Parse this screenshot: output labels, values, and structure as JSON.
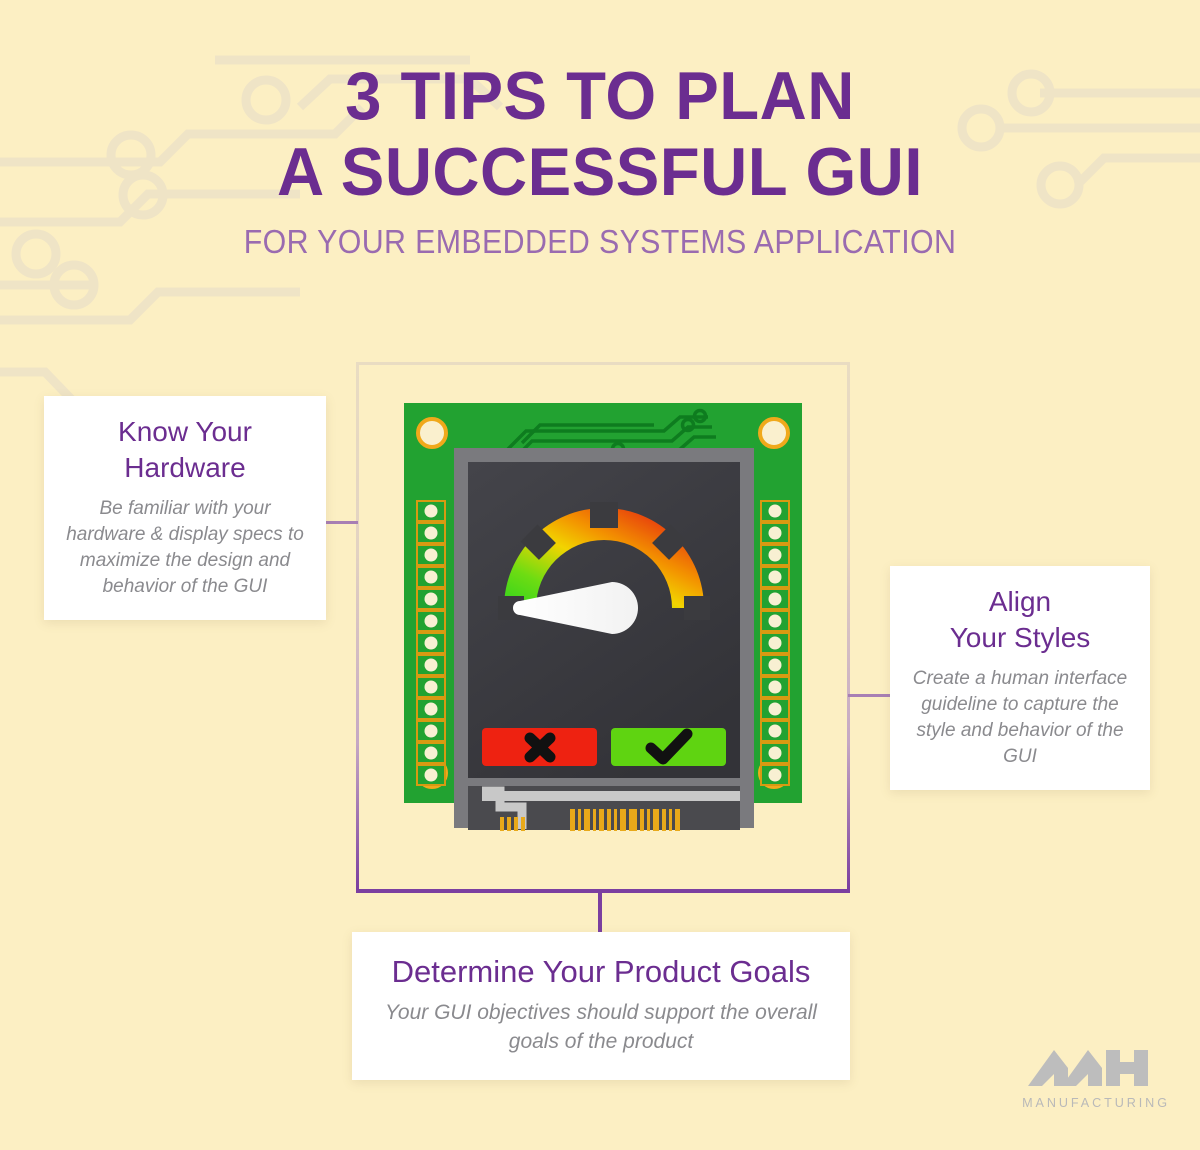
{
  "page": {
    "background_color": "#FCEFC3",
    "accent_purple": "#6B2D90",
    "subtitle_purple": "#9A6BB0",
    "connector_purple": "#A87FB4",
    "body_grey": "#8A8A8E",
    "trace_color": "#EFE4C6"
  },
  "header": {
    "title_line1": "3 TIPS TO PLAN",
    "title_line2": "A SUCCESSFUL GUI",
    "subtitle": "FOR YOUR EMBEDDED SYSTEMS APPLICATION"
  },
  "callouts": [
    {
      "id": "know-your-hardware",
      "title_line1": "Know Your",
      "title_line2": "Hardware",
      "body": "Be familiar with your hardware & display specs to maximize the design and behavior of the GUI"
    },
    {
      "id": "align-your-styles",
      "title_line1": "Align",
      "title_line2": "Your Styles",
      "body": "Create a human interface guideline to capture the style and behavior of the GUI"
    },
    {
      "id": "determine-your-product-goals",
      "title_line1": "Determine Your Product Goals",
      "title_line2": "",
      "body": "Your GUI objectives should support the overall goals of the product"
    }
  ],
  "device": {
    "name": "embedded-display-board",
    "board_color": "#22A231",
    "board_trace_color": "#0F7A20",
    "bezel_color": "#7A7A7E",
    "screen_color": "#3B3B3F",
    "mount_hole_count": 4,
    "pin_pad_count_per_side": 14,
    "pin_pad_color": "#F7EFD0",
    "pin_pad_outline": "#D79A12",
    "gauge": {
      "name": "speedometer-gauge",
      "arc_colors": [
        "#38D430",
        "#8CDC10",
        "#F2D400",
        "#F08A00",
        "#E23A10",
        "#D91A0B"
      ],
      "needle_color": "#FFFFFF",
      "needle_direction": "left",
      "tick_count": 5
    },
    "buttons": [
      {
        "id": "cancel-button",
        "icon": "cross-icon",
        "color": "#EE2211",
        "glyph": "✖"
      },
      {
        "id": "confirm-button",
        "icon": "check-icon",
        "color": "#5FD411",
        "glyph": "✔"
      }
    ],
    "connector": {
      "name": "ribbon-cable-connector",
      "contact_color": "#E8A91A"
    }
  },
  "logo": {
    "mark": "MH",
    "wordmark": "MANUFACTURING",
    "color": "#BDBDBD"
  }
}
